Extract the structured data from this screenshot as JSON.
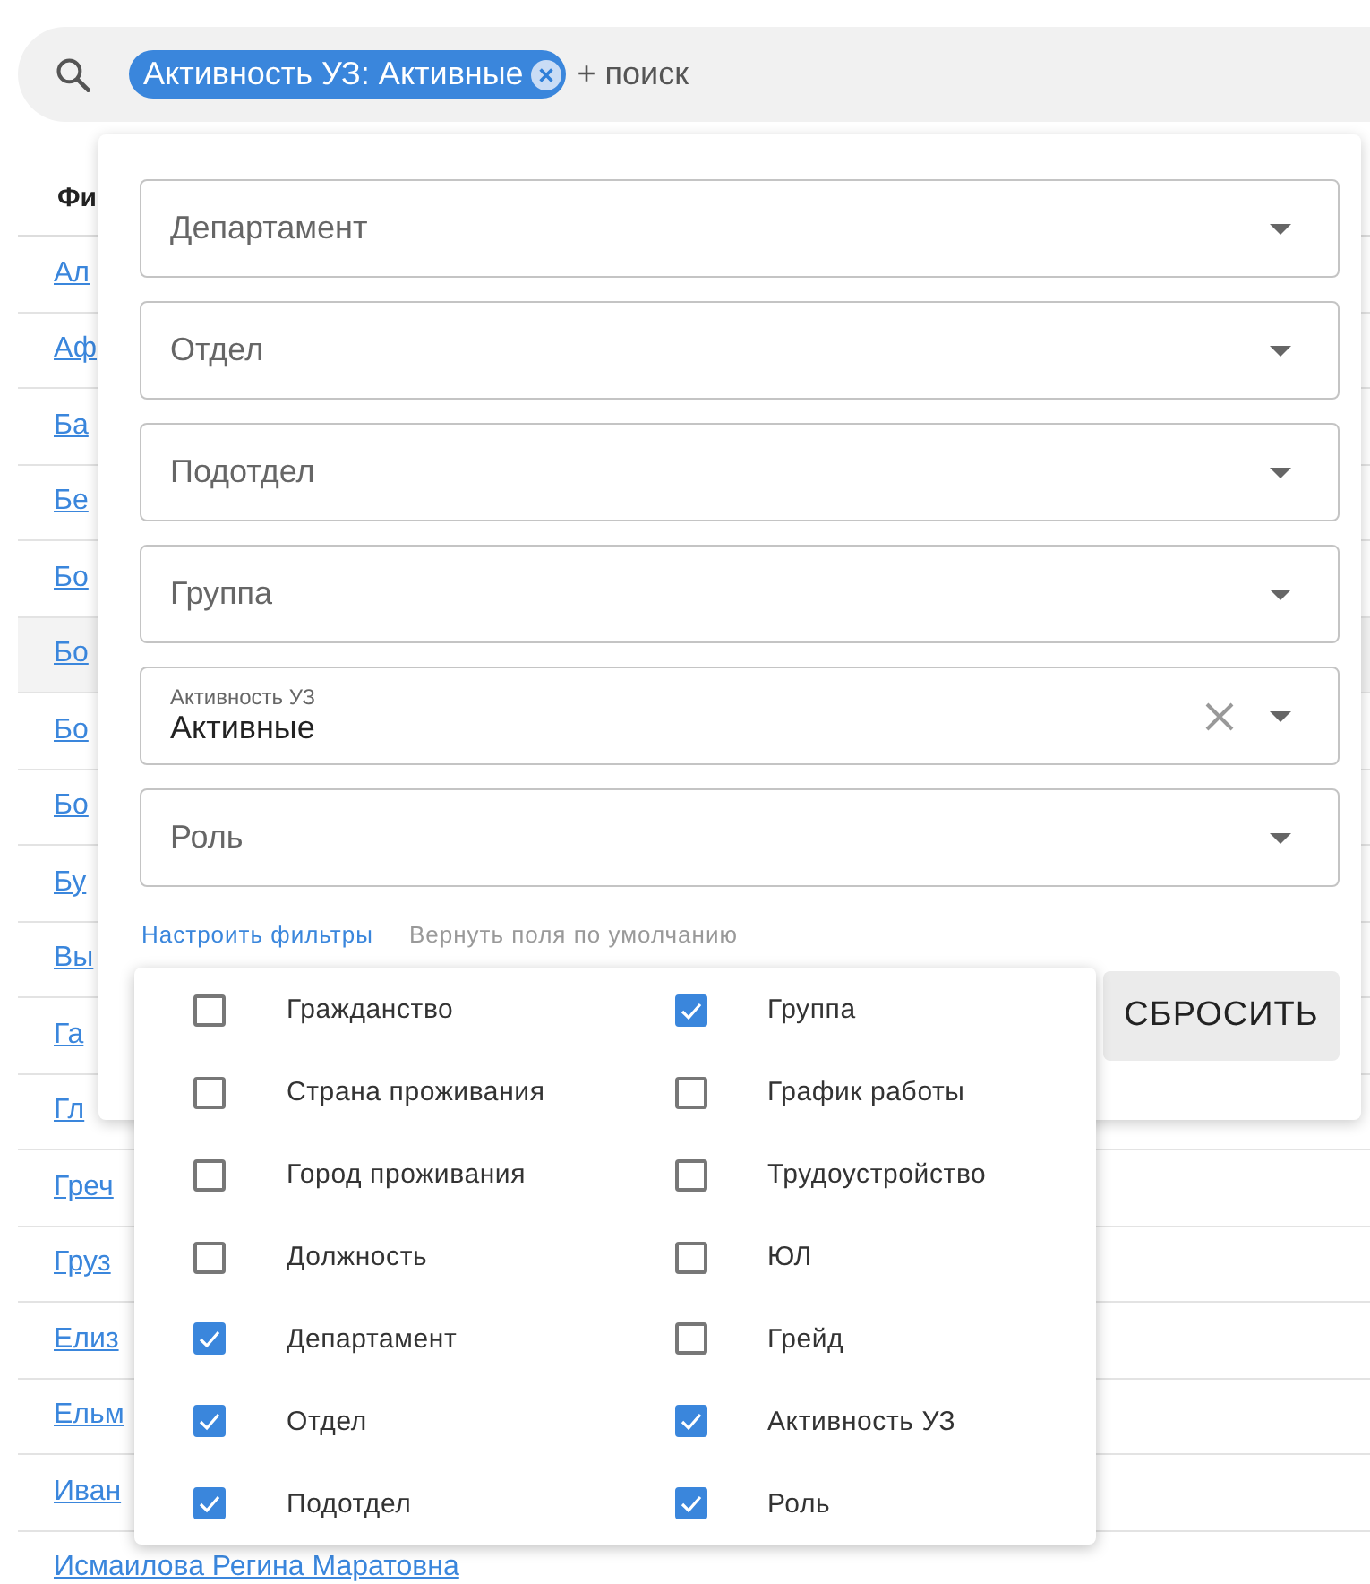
{
  "search": {
    "chip": {
      "label": "Активность УЗ: Активные"
    },
    "add_label": "+ поиск"
  },
  "table": {
    "header": "Фи",
    "rows": [
      {
        "name": "Ал",
        "selected": false
      },
      {
        "name": "Аф",
        "selected": false
      },
      {
        "name": "Ба",
        "selected": false
      },
      {
        "name": "Бе",
        "selected": false
      },
      {
        "name": "Бо",
        "selected": false
      },
      {
        "name": "Бо",
        "selected": true
      },
      {
        "name": "Бо",
        "selected": false
      },
      {
        "name": "Бо",
        "selected": false
      },
      {
        "name": "Бу",
        "selected": false
      },
      {
        "name": "Вы",
        "selected": false
      },
      {
        "name": "Га",
        "selected": false
      },
      {
        "name": "Гл",
        "selected": false
      },
      {
        "name": "Греч",
        "selected": false
      },
      {
        "name": "Груз",
        "selected": false
      },
      {
        "name": "Елиз",
        "selected": false
      },
      {
        "name": "Ельм",
        "selected": false
      },
      {
        "name": "Иван",
        "selected": false
      },
      {
        "name": "Исмаилова Регина Маратовна",
        "selected": false
      }
    ]
  },
  "filter_panel": {
    "fields": [
      {
        "label": "Департамент"
      },
      {
        "label": "Отдел"
      },
      {
        "label": "Подотдел"
      },
      {
        "label": "Группа"
      },
      {
        "label": "Активность УЗ",
        "value": "Активные"
      },
      {
        "label": "Роль"
      }
    ],
    "configure_link": "Настроить фильтры",
    "reset_fields_link": "Вернуть поля по умолчанию",
    "reset_button": "СБРОСИТЬ"
  },
  "columns_menu": {
    "columns": [
      {
        "items": [
          {
            "label": "Гражданство",
            "checked": false
          },
          {
            "label": "Страна проживания",
            "checked": false
          },
          {
            "label": "Город проживания",
            "checked": false
          },
          {
            "label": "Должность",
            "checked": false
          },
          {
            "label": "Департамент",
            "checked": true
          },
          {
            "label": "Отдел",
            "checked": true
          },
          {
            "label": "Подотдел",
            "checked": true
          }
        ]
      },
      {
        "items": [
          {
            "label": "Группа",
            "checked": true
          },
          {
            "label": "График работы",
            "checked": false
          },
          {
            "label": "Трудоустройство",
            "checked": false
          },
          {
            "label": "ЮЛ",
            "checked": false
          },
          {
            "label": "Грейд",
            "checked": false
          },
          {
            "label": "Активность УЗ",
            "checked": true
          },
          {
            "label": "Роль",
            "checked": true
          }
        ]
      }
    ]
  }
}
